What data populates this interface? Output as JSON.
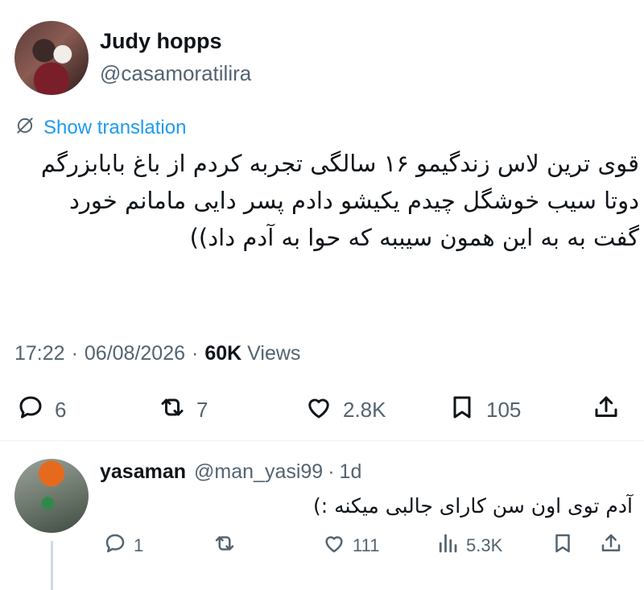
{
  "tweet": {
    "author": {
      "display_name": "Judy hopps",
      "handle": "@casamoratilira"
    },
    "translate_label": "Show translation",
    "text": "قوی ترین لاس زندگیمو ۱۶ سالگی تجربه کردم از باغ بابابزرگم دوتا سیب خوشگل چیدم یکیشو دادم پسر دایی مامانم خورد گفت به به این همون سیببه که حوا به آدم داد))",
    "time": "17:22",
    "date": "06/08/2026",
    "views_count": "60K",
    "views_label": "Views",
    "stats": {
      "replies": "6",
      "reposts": "7",
      "likes": "2.8K",
      "bookmarks": "105"
    }
  },
  "reply": {
    "author": {
      "display_name": "yasaman",
      "handle": "@man_yasi99",
      "age": "1d"
    },
    "text": "آدم توی اون سن کارای جالبی میکنه :)",
    "stats": {
      "replies": "1",
      "reposts": "",
      "likes": "111",
      "views": "5.3K"
    }
  },
  "icons": [
    "translate-icon",
    "reply-icon",
    "repost-icon",
    "like-icon",
    "bookmark-icon",
    "share-icon",
    "views-icon"
  ],
  "colors": {
    "accent": "#1d9bf0",
    "text": "#0f1419",
    "muted": "#536471",
    "divider": "#eff3f4"
  }
}
